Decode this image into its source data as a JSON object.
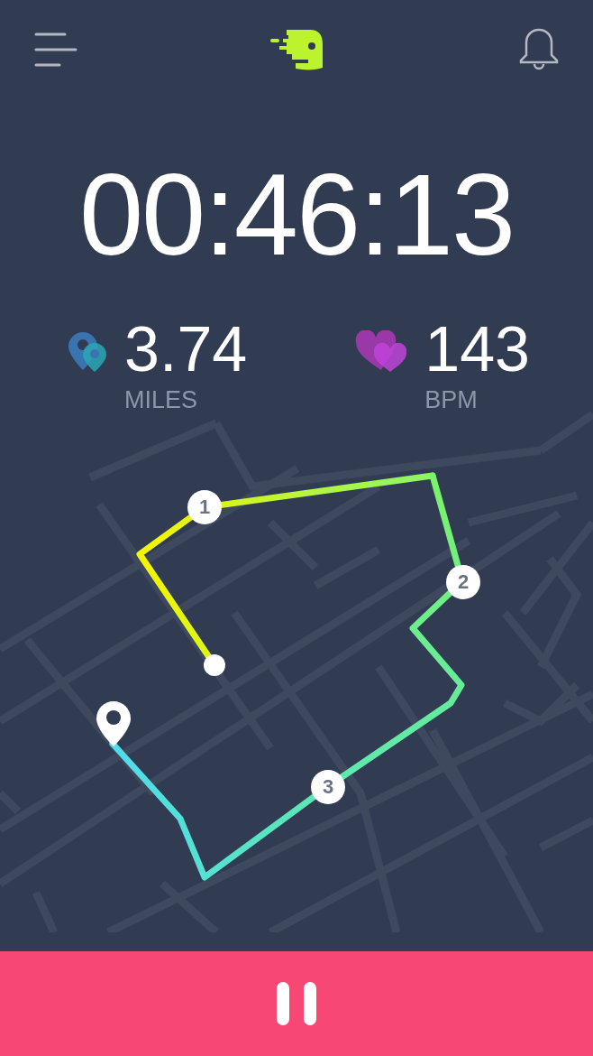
{
  "timer": "00:46:13",
  "stats": [
    {
      "kind": "distance",
      "value": "3.74",
      "unit": "MILES"
    },
    {
      "kind": "heart_rate",
      "value": "143",
      "unit": "BPM"
    }
  ],
  "route": {
    "markers": [
      {
        "label": "1"
      },
      {
        "label": "2"
      },
      {
        "label": "3"
      }
    ]
  }
}
